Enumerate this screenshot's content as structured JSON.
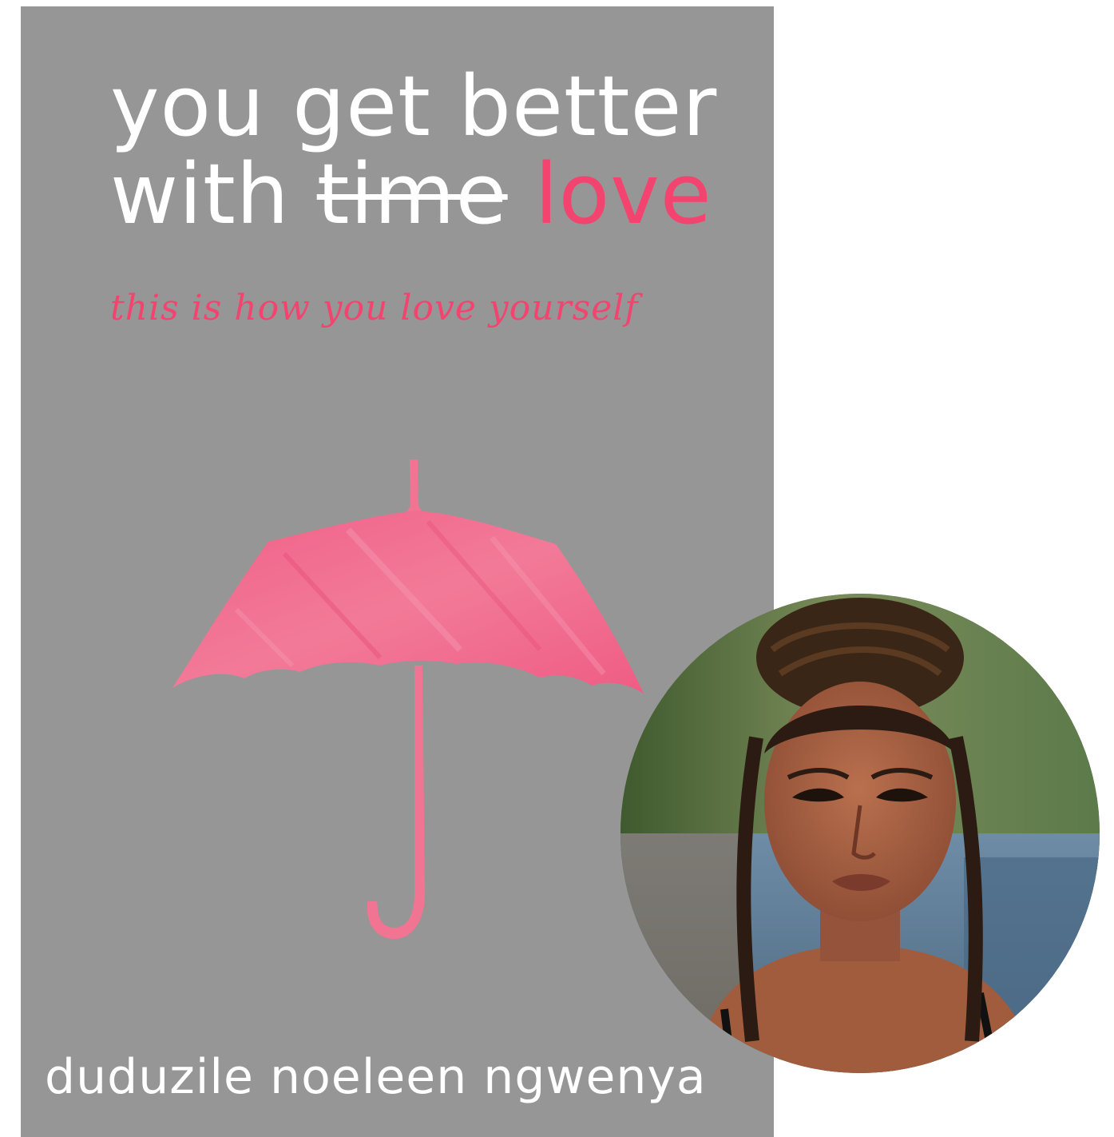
{
  "cover": {
    "title_line1": "you get better",
    "title_word_with": "with ",
    "title_word_struck": "time",
    "title_word_pink": "love",
    "subtitle": "this is how you love yourself",
    "author": "duduzile noeleen ngwenya",
    "colors": {
      "background": "#969696",
      "accent_pink": "#f2446e",
      "umbrella_pink": "#f27493",
      "text_white": "#ffffff"
    },
    "illustration": "pink-umbrella"
  },
  "portrait": {
    "subject": "author-portrait"
  }
}
